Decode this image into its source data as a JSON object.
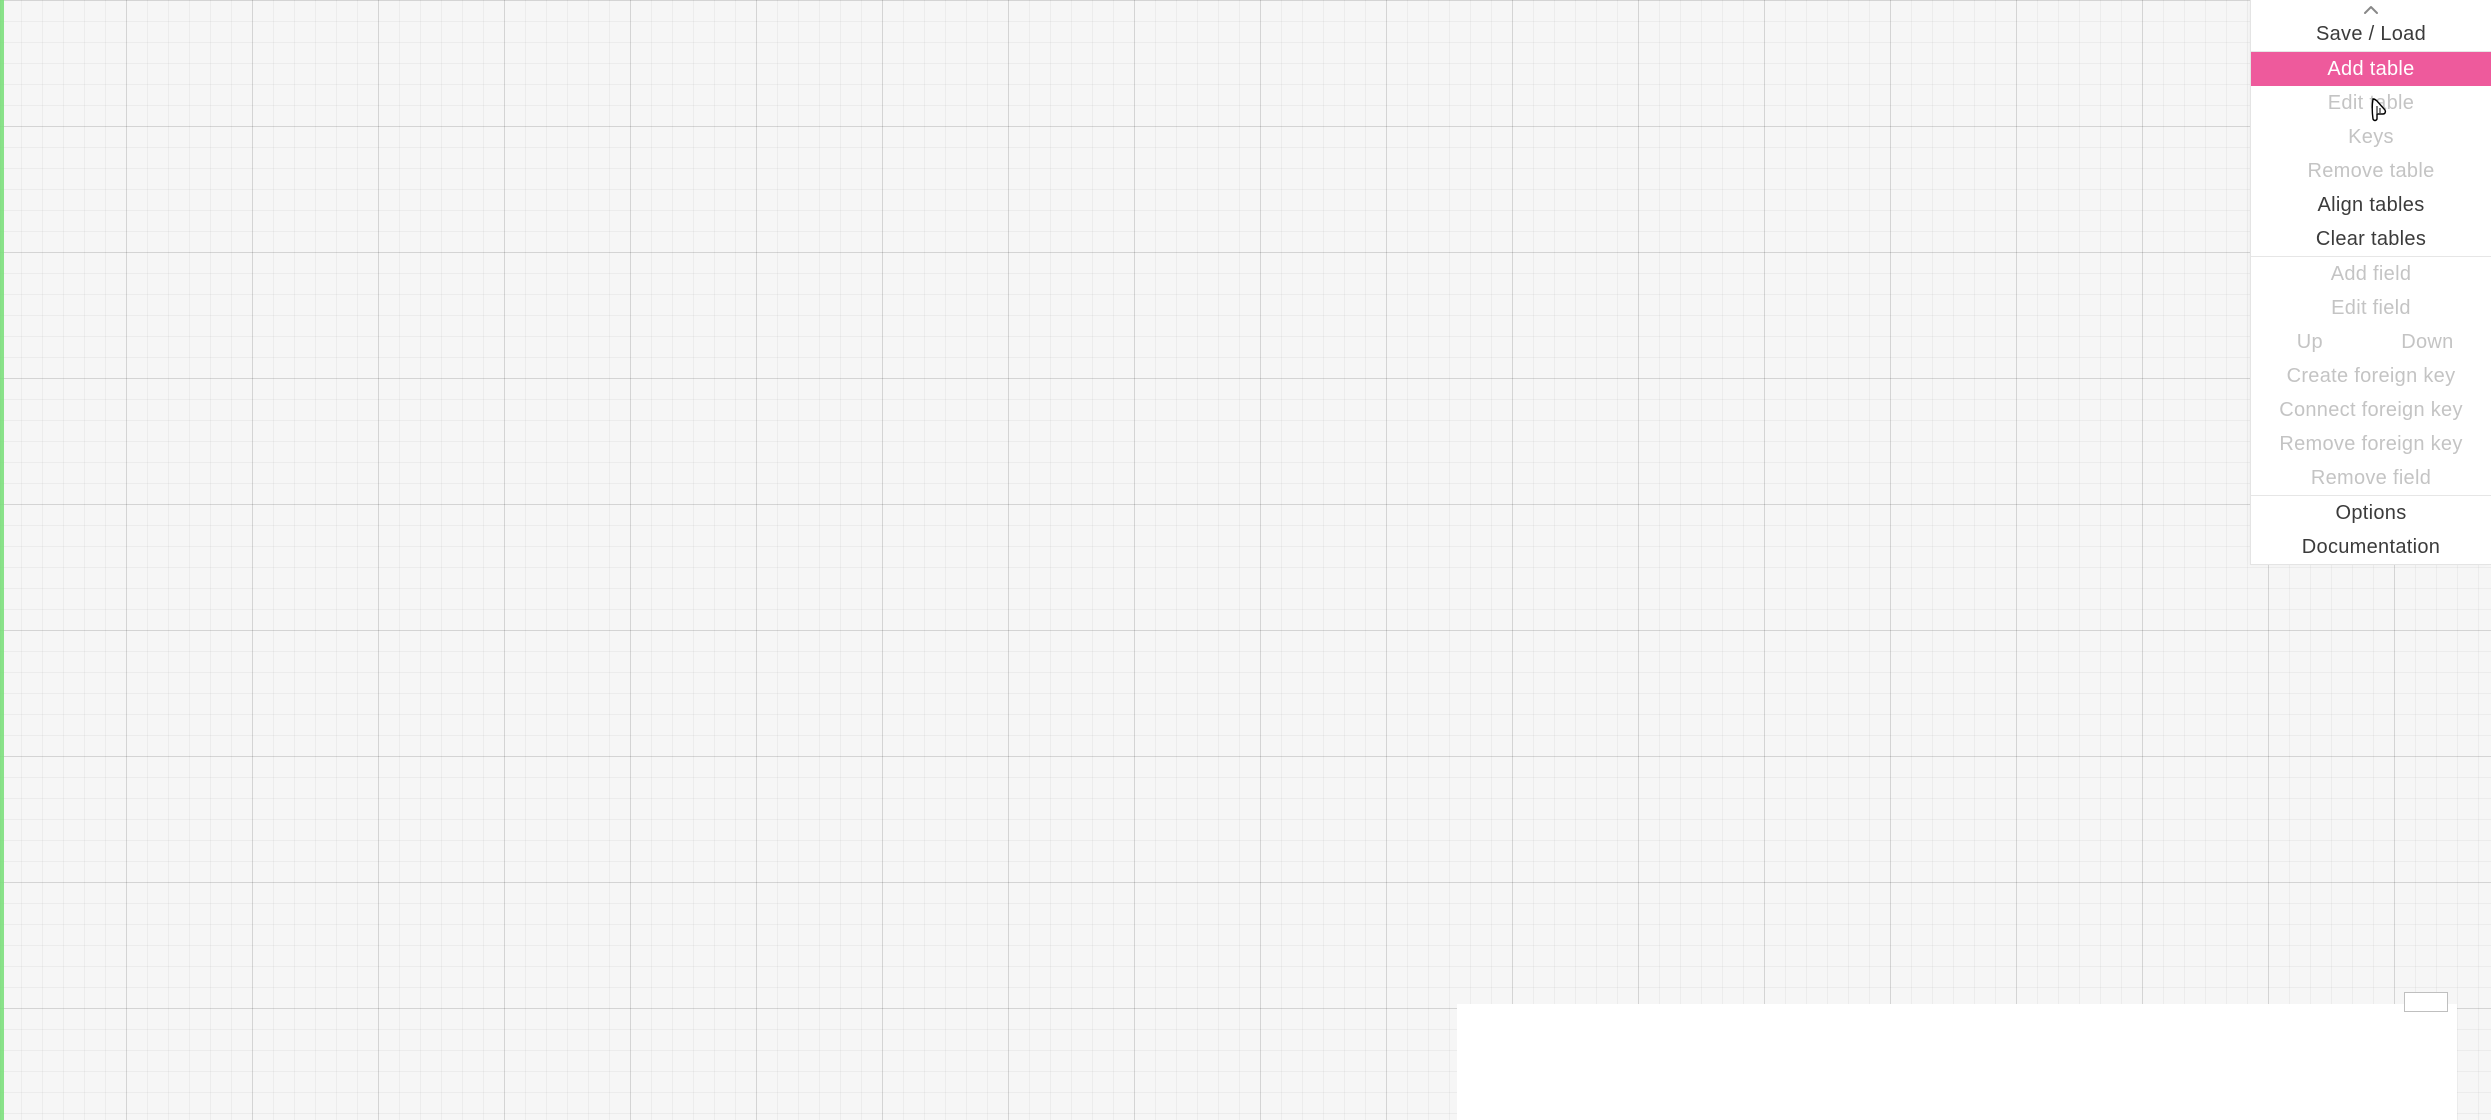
{
  "sidebar": {
    "save_load": "Save / Load",
    "table_ops": {
      "add_table": {
        "label": "Add table",
        "enabled": true,
        "highlighted": true
      },
      "edit_table": {
        "label": "Edit table",
        "enabled": false
      },
      "keys": {
        "label": "Keys",
        "enabled": false
      },
      "remove_table": {
        "label": "Remove table",
        "enabled": false
      },
      "align_tables": {
        "label": "Align tables",
        "enabled": true
      },
      "clear_tables": {
        "label": "Clear tables",
        "enabled": true
      }
    },
    "field_ops": {
      "add_field": {
        "label": "Add field",
        "enabled": false
      },
      "edit_field": {
        "label": "Edit field",
        "enabled": false
      },
      "up": {
        "label": "Up",
        "enabled": false
      },
      "down": {
        "label": "Down",
        "enabled": false
      },
      "create_foreign_key": {
        "label": "Create foreign key",
        "enabled": false
      },
      "connect_foreign_key": {
        "label": "Connect foreign key",
        "enabled": false
      },
      "remove_foreign_key": {
        "label": "Remove foreign key",
        "enabled": false
      },
      "remove_field": {
        "label": "Remove field",
        "enabled": false
      }
    },
    "footer": {
      "options": "Options",
      "documentation": "Documentation"
    }
  },
  "colors": {
    "accent_pink": "#ee5a9c",
    "green_edge": "#7de07d",
    "disabled": "#c4c4c4",
    "enabled": "#3b3b3b"
  }
}
